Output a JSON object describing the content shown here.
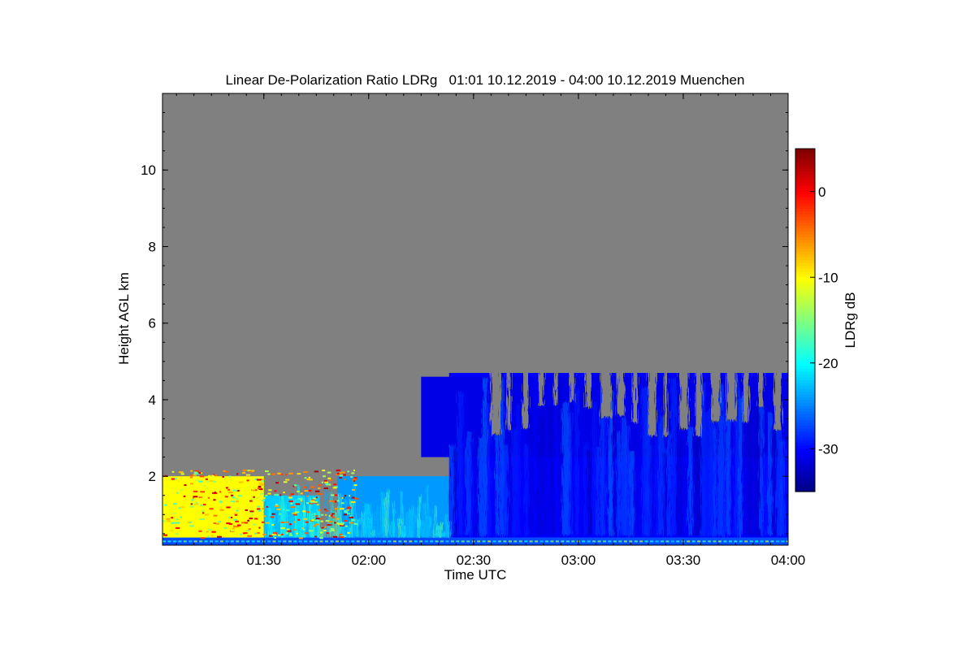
{
  "chart_data": {
    "type": "heatmap",
    "title": "Linear De-Polarization Ratio LDRg   01:01 10.12.2019 - 04:00 10.12.2019 Muenchen",
    "xlabel": "Time UTC",
    "ylabel": "Height AGL km",
    "x_range": [
      "01:01",
      "04:00"
    ],
    "xlim_minutes": [
      61,
      240
    ],
    "x_ticks": [
      {
        "label": "01:30",
        "minutes": 90
      },
      {
        "label": "02:00",
        "minutes": 120
      },
      {
        "label": "02:30",
        "minutes": 150
      },
      {
        "label": "03:00",
        "minutes": 180
      },
      {
        "label": "03:30",
        "minutes": 210
      },
      {
        "label": "04:00",
        "minutes": 240
      }
    ],
    "ylim": [
      0.2,
      12
    ],
    "y_ticks": [
      2,
      4,
      6,
      8,
      10
    ],
    "colorbar": {
      "label": "LDRg dB",
      "range": [
        -35,
        5
      ],
      "ticks": [
        {
          "label": "0",
          "value": 0
        },
        {
          "label": "-10",
          "value": -10
        },
        {
          "label": "-20",
          "value": -20
        },
        {
          "label": "-30",
          "value": -30
        }
      ],
      "colormap": "jet"
    },
    "background_color": "#808080",
    "regions": [
      {
        "name": "Near-surface layer",
        "t_start": 61,
        "t_end": 240,
        "h_bottom": 0.2,
        "h_top": 0.4,
        "ldr_db": -27
      },
      {
        "name": "Low clutter echoes",
        "t_start": 61,
        "t_end": 90,
        "h_bottom": 0.4,
        "h_top": 2.0,
        "ldr_db": -10
      },
      {
        "name": "Low cloud 01:30-02:00",
        "t_start": 90,
        "t_end": 106,
        "h_bottom": 0.4,
        "h_top": 1.5,
        "ldr_db": -22
      },
      {
        "name": "Precipitation onset",
        "t_start": 111,
        "t_end": 143,
        "h_bottom": 0.4,
        "h_top": 2.0,
        "ldr_db": -24
      },
      {
        "name": "Main cloud system",
        "t_start": 143,
        "t_end": 240,
        "h_bottom": 0.4,
        "h_top": 4.7,
        "ldr_db": -30
      },
      {
        "name": "Embedded cirrus streaks",
        "t_start": 135,
        "t_end": 240,
        "h_bottom": 2.5,
        "h_top": 4.6,
        "ldr_db": -31
      }
    ]
  }
}
